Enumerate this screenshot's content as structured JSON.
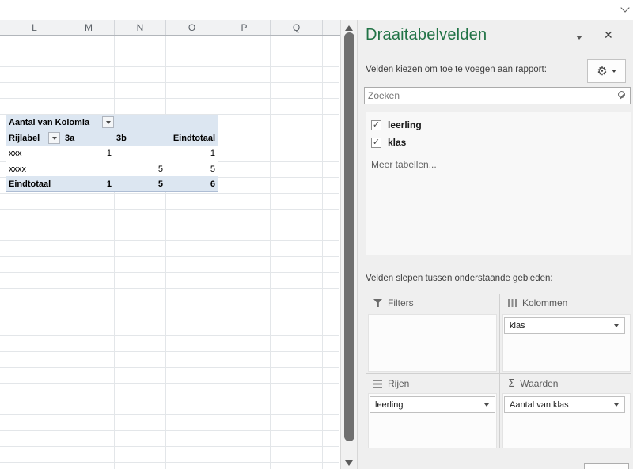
{
  "sheet": {
    "columns": [
      "L",
      "M",
      "N",
      "O",
      "P",
      "Q"
    ],
    "pivot": {
      "r1_label": "Aantal van Kolomla",
      "r2": [
        "Rijlabel",
        "3a",
        "3b",
        "Eindtotaal"
      ],
      "data_rows": [
        {
          "label": "xxx",
          "m": "1",
          "n": "",
          "o": "1"
        },
        {
          "label": "xxxx",
          "m": "",
          "n": "5",
          "o": "5"
        },
        {
          "label": "Eindtotaal",
          "m": "1",
          "n": "5",
          "o": "6"
        }
      ]
    }
  },
  "pane": {
    "title": "Draaitabelvelden",
    "choose_fields_text": "Velden kiezen om toe te voegen aan rapport:",
    "search": {
      "placeholder": "Zoeken"
    },
    "fields": [
      {
        "label": "leerling",
        "checked": true
      },
      {
        "label": "klas",
        "checked": true
      }
    ],
    "more_tables_text": "Meer tabellen...",
    "drag_text": "Velden slepen tussen onderstaande gebieden:",
    "areas": {
      "filters": {
        "label": "Filters",
        "items": []
      },
      "columns": {
        "label": "Kolommen",
        "items": [
          "klas"
        ]
      },
      "rows": {
        "label": "Rijen",
        "items": [
          "leerling"
        ]
      },
      "values": {
        "label": "Waarden",
        "items": [
          "Aantal van klas"
        ]
      }
    }
  },
  "icons": {
    "close": "✕",
    "gear": "⚙",
    "sigma": "Σ",
    "check": "✓"
  },
  "colors": {
    "accent_green": "#217346",
    "pivot_header_bg": "#dce6f1"
  }
}
